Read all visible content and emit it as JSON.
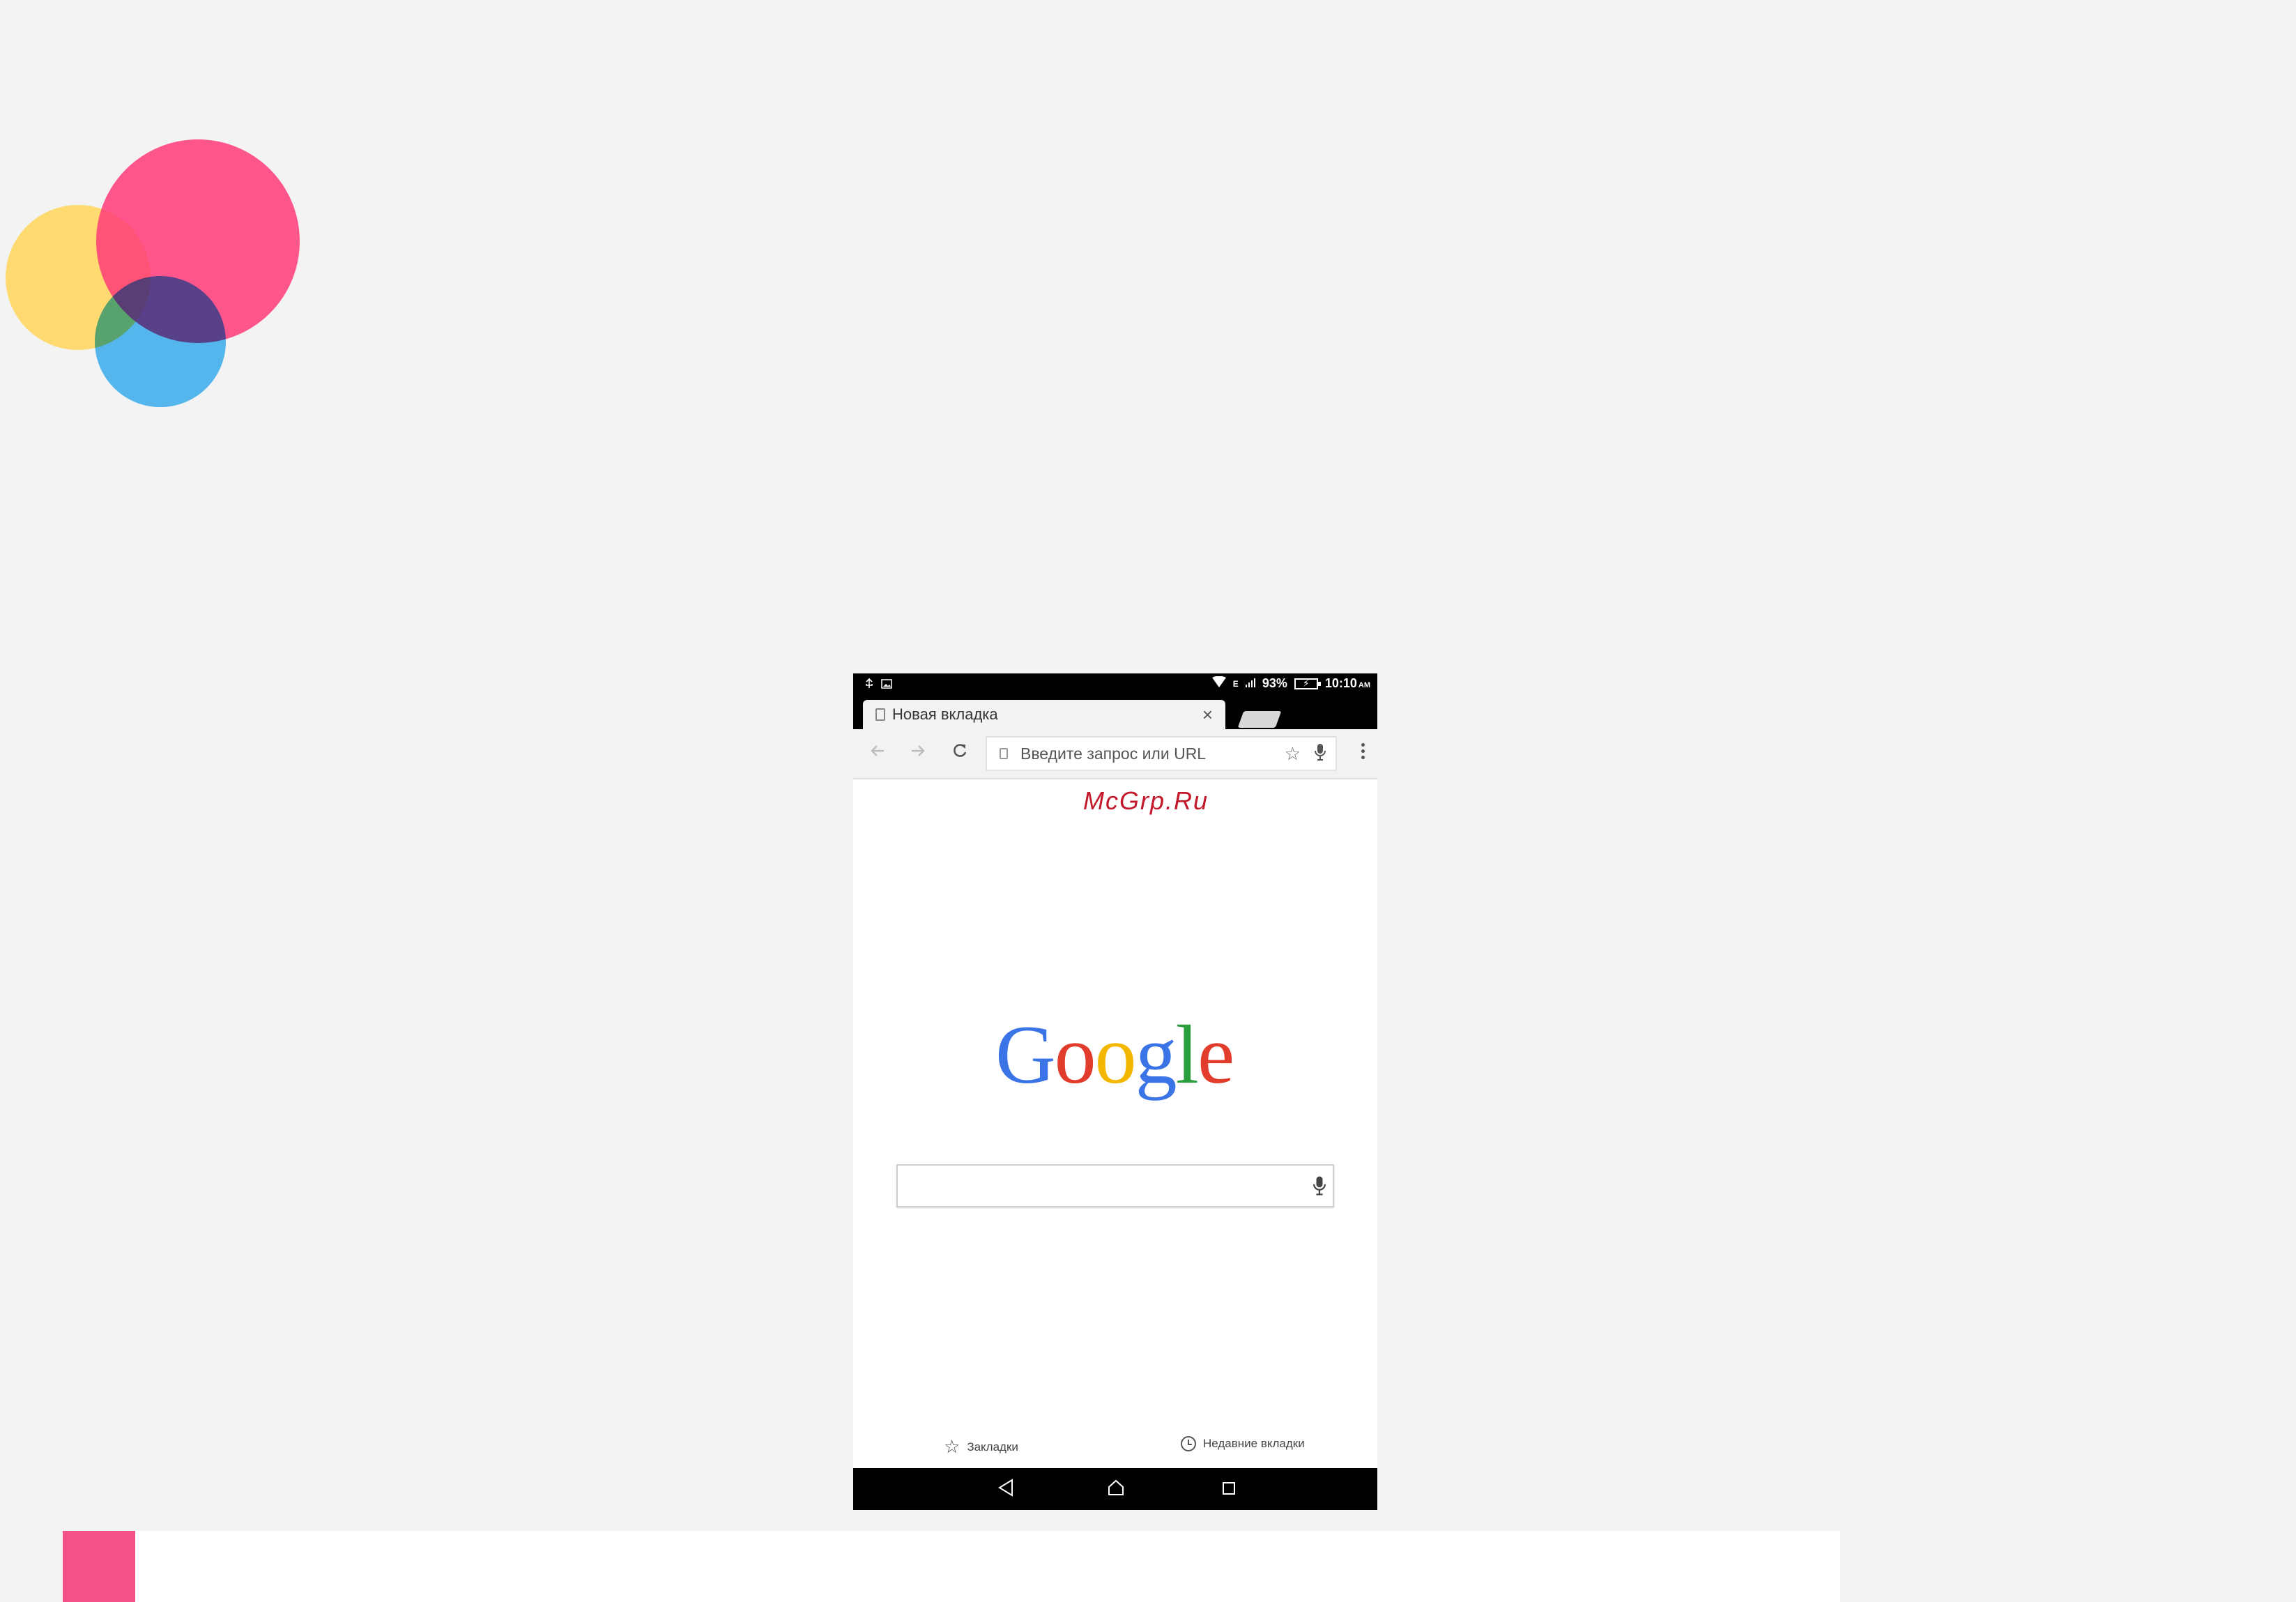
{
  "status_bar": {
    "battery": "93%",
    "time": "10:10",
    "ampm": "AM",
    "network": "E"
  },
  "tab": {
    "title": "Новая вкладка",
    "close_glyph": "×"
  },
  "toolbar": {
    "omnibox_placeholder": "Введите запрос или URL"
  },
  "watermark": "McGrp.Ru",
  "logo": {
    "letters": [
      "G",
      "o",
      "o",
      "g",
      "l",
      "e"
    ]
  },
  "footer": {
    "bookmarks_label": "Закладки",
    "recent_tabs_label": "Недавние вкладки"
  },
  "icons": {
    "usb": "usb-icon",
    "image": "image-icon",
    "wifi": "wifi-icon",
    "signal": "signal-icon",
    "battery": "battery-icon",
    "back": "arrow-left-icon",
    "forward": "arrow-right-icon",
    "reload": "reload-icon",
    "star": "star-icon",
    "mic": "mic-icon",
    "menu": "more-vert-icon",
    "clock": "clock-icon",
    "nav_back": "triangle-back-icon",
    "nav_home": "home-icon",
    "nav_recent": "square-recent-icon"
  },
  "colors": {
    "google_blue": "#3b74e6",
    "google_red": "#e23c2c",
    "google_yellow": "#f3b700",
    "google_green": "#2a9d3d",
    "accent_pink": "#f4508a"
  }
}
